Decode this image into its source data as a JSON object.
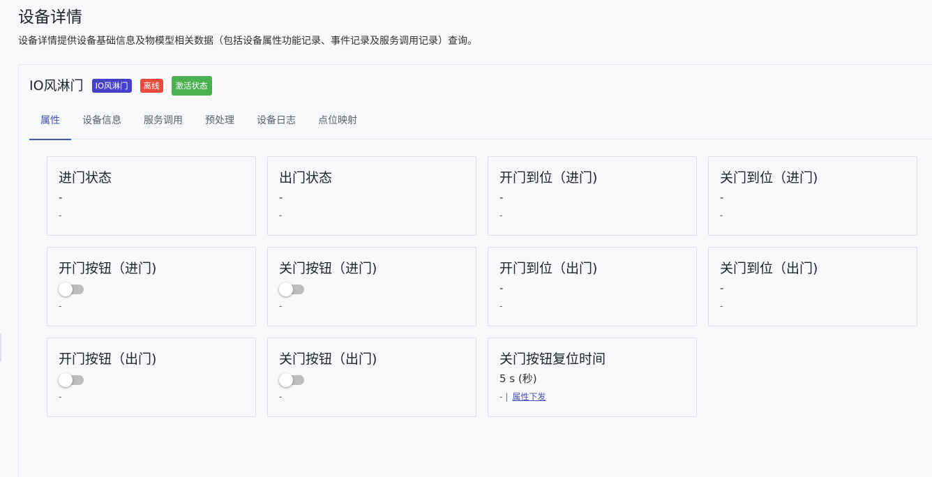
{
  "page": {
    "title": "设备详情",
    "description": "设备详情提供设备基础信息及物模型相关数据（包括设备属性功能记录、事件记录及服务调用记录）查询。"
  },
  "device": {
    "name": "IO风淋门",
    "type_tag": "IO风淋门",
    "status_tag": "离线",
    "activate_label": "激活状态",
    "colors": {
      "type_tag": "#4641c9",
      "status_tag": "#e74c3c",
      "activate": "#4caf50",
      "accent": "#3f51b5"
    }
  },
  "tabs": [
    {
      "label": "属性",
      "active": true
    },
    {
      "label": "设备信息"
    },
    {
      "label": "服务调用"
    },
    {
      "label": "预处理"
    },
    {
      "label": "设备日志"
    },
    {
      "label": "点位映射"
    }
  ],
  "properties": [
    {
      "title": "进门状态",
      "value": "-",
      "foot": "-"
    },
    {
      "title": "出门状态",
      "value": "-",
      "foot": "-"
    },
    {
      "title": "开门到位（进门)",
      "value": "-",
      "foot": "-"
    },
    {
      "title": "关门到位（进门)",
      "value": "-",
      "foot": "-"
    },
    {
      "title": "开门按钮（进门)",
      "value": "off",
      "foot": "-"
    },
    {
      "title": "关门按钮（进门)",
      "value": "off",
      "foot": "-"
    },
    {
      "title": "开门到位（出门)",
      "value": "-",
      "foot": "-"
    },
    {
      "title": "关门到位（出门)",
      "value": "-",
      "foot": "-"
    },
    {
      "title": "开门按钮（出门)",
      "value": "off",
      "foot": "-"
    },
    {
      "title": "关门按钮（出门)",
      "value": "off",
      "foot": "-"
    },
    {
      "title": "关门按钮复位时间",
      "value": "5 s (秒)",
      "foot": "-",
      "foot_separator": "|",
      "action": "属性下发"
    }
  ]
}
